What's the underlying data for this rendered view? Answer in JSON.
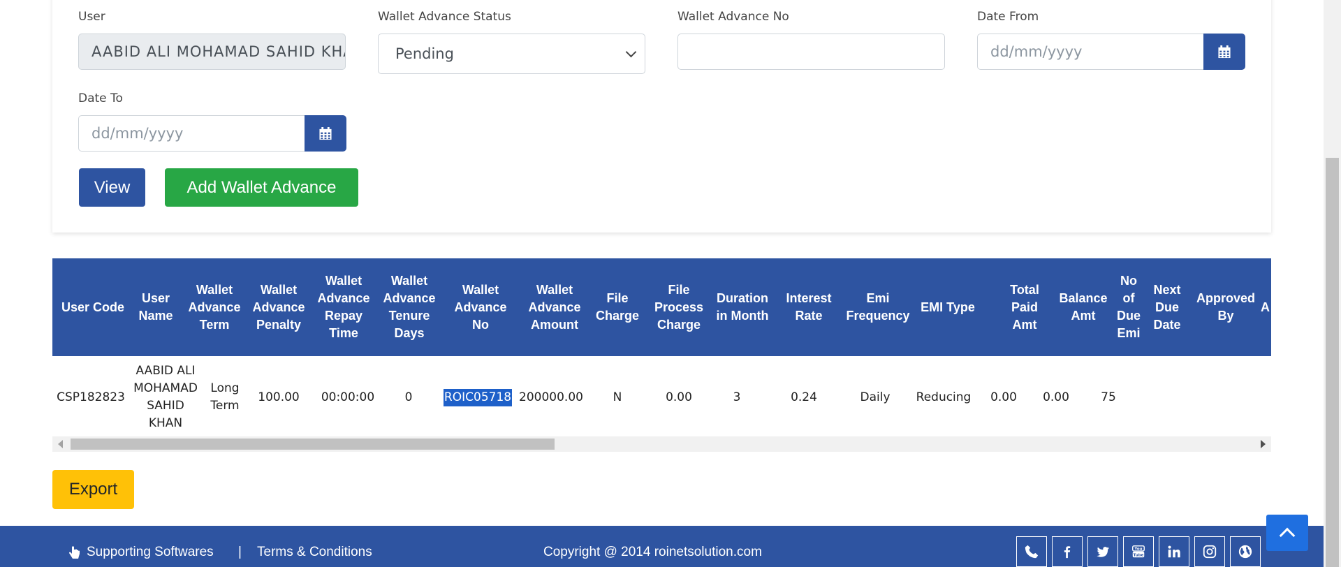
{
  "filters": {
    "user": {
      "label": "User",
      "value": "AABID ALI MOHAMAD  SAHID KHAN"
    },
    "status": {
      "label": "Wallet Advance Status",
      "value": "Pending"
    },
    "advance_no": {
      "label": "Wallet Advance No",
      "value": ""
    },
    "date_from": {
      "label": "Date From",
      "placeholder": "dd/mm/yyyy"
    },
    "date_to": {
      "label": "Date To",
      "placeholder": "dd/mm/yyyy"
    }
  },
  "buttons": {
    "view": "View",
    "add": "Add Wallet Advance",
    "export": "Export"
  },
  "table": {
    "headers": [
      "User Code",
      "User Name",
      "Wallet Advance Term",
      "Wallet Advance Penalty",
      "Wallet Advance Repay Time",
      "Wallet Advance Tenure Days",
      "Wallet Advance No",
      "Wallet Advance Amount",
      "File Charge",
      "File Process Charge",
      "Duration in Month",
      "Interest Rate",
      "Emi Frequency",
      "EMI Type",
      "Total Paid Amt",
      "Balance Amt",
      "No of Due Emi",
      "Next Due Date",
      "Approved By",
      "A"
    ],
    "rows": [
      [
        "CSP182823",
        "AABID ALI MOHAMAD SAHID KHAN",
        "Long Term",
        "100.00",
        "00:00:00",
        "0",
        "ROIC05718",
        "200000.00",
        "N",
        "0.00",
        "3",
        "0.24",
        "Daily",
        "Reducing",
        "0.00",
        "0.00",
        "75",
        "",
        "",
        ""
      ]
    ],
    "highlighted_cell": "ROIC05718"
  },
  "footer": {
    "supporting": "Supporting Softwares",
    "separator": "|",
    "terms": "Terms & Conditions",
    "copyright": "Copyright @ 2014 roinetsolution.com",
    "social_icons": [
      "phone-icon",
      "facebook-icon",
      "twitter-icon",
      "youtube-icon",
      "linkedin-icon",
      "instagram-icon",
      "globe-icon"
    ]
  },
  "colors": {
    "primary": "#2e54a1",
    "success": "#28a745",
    "warning": "#ffc107",
    "scroll_top": "#1f6fe0"
  }
}
